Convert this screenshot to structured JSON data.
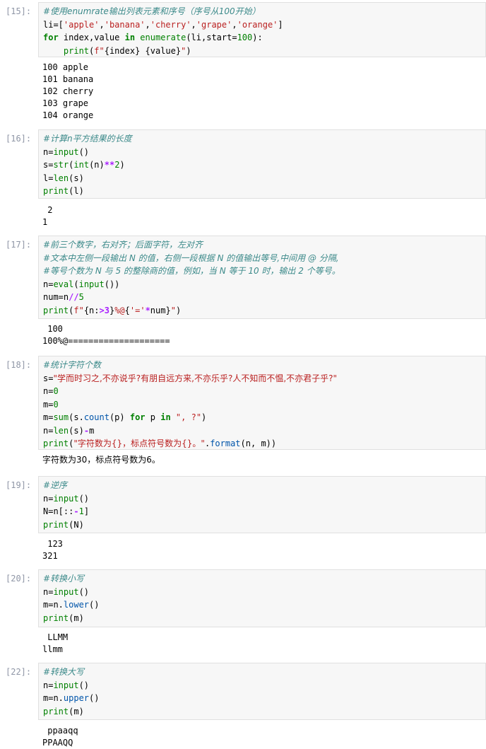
{
  "cells": [
    {
      "prompt": "[15]:",
      "code": [
        [
          [
            "cm",
            "#使用enumrate输出列表元素和序号（序号从100开始）"
          ]
        ],
        [
          [
            "",
            "li=["
          ],
          [
            "st",
            "'apple'"
          ],
          [
            "",
            ","
          ],
          [
            "st",
            "'banana'"
          ],
          [
            "",
            ","
          ],
          [
            "st",
            "'cherry'"
          ],
          [
            "",
            ","
          ],
          [
            "st",
            "'grape'"
          ],
          [
            "",
            ","
          ],
          [
            "st",
            "'orange'"
          ],
          [
            "",
            "]"
          ]
        ],
        [
          [
            "kw",
            "for"
          ],
          [
            "",
            " index,value "
          ],
          [
            "kw",
            "in"
          ],
          [
            "",
            " "
          ],
          [
            "bi",
            "enumerate"
          ],
          [
            "",
            "(li,start="
          ],
          [
            "nm",
            "100"
          ],
          [
            "",
            "):"
          ]
        ],
        [
          [
            "",
            "    "
          ],
          [
            "bi",
            "print"
          ],
          [
            "",
            "("
          ],
          [
            "st",
            "f\""
          ],
          [
            "",
            "{index}"
          ],
          [
            "st",
            " "
          ],
          [
            "",
            "{value}"
          ],
          [
            "st",
            "\""
          ],
          [
            "",
            ")"
          ]
        ]
      ],
      "output": [
        "100 apple",
        "101 banana",
        "102 cherry",
        "103 grape",
        "104 orange"
      ]
    },
    {
      "prompt": "[16]:",
      "code": [
        [
          [
            "cm",
            "#计算n平方结果的长度"
          ]
        ],
        [
          [
            "",
            "n="
          ],
          [
            "bi",
            "input"
          ],
          [
            "",
            "()"
          ]
        ],
        [
          [
            "",
            "s="
          ],
          [
            "bi",
            "str"
          ],
          [
            "",
            "("
          ],
          [
            "bi",
            "int"
          ],
          [
            "",
            "(n)"
          ],
          [
            "op",
            "**"
          ],
          [
            "nm",
            "2"
          ],
          [
            "",
            ")"
          ]
        ],
        [
          [
            "",
            "l="
          ],
          [
            "bi",
            "len"
          ],
          [
            "",
            "(s)"
          ]
        ],
        [
          [
            "bi",
            "print"
          ],
          [
            "",
            "(l)"
          ]
        ]
      ],
      "output": [
        " 2",
        "1"
      ]
    },
    {
      "prompt": "[17]:",
      "code": [
        [
          [
            "cm",
            "#前三个数字，右对齐；后面字符，左对齐"
          ]
        ],
        [
          [
            "cm",
            "#文本中左侧一段输出 N 的值，右侧一段根据 N 的值输出等号,中间用 @ 分隔,"
          ]
        ],
        [
          [
            "cm",
            "#等号个数为 N 与 5 的整除商的值，例如，当 N 等于 10 时，输出 2 个等号。"
          ]
        ],
        [
          [
            "",
            "n="
          ],
          [
            "bi",
            "eval"
          ],
          [
            "",
            "("
          ],
          [
            "bi",
            "input"
          ],
          [
            "",
            "())"
          ]
        ],
        [
          [
            "",
            "num=n"
          ],
          [
            "op",
            "//"
          ],
          [
            "nm",
            "5"
          ]
        ],
        [
          [
            "bi",
            "print"
          ],
          [
            "",
            "("
          ],
          [
            "st",
            "f\""
          ],
          [
            "",
            "{n:"
          ],
          [
            "op",
            ">3"
          ],
          [
            "",
            "}"
          ],
          [
            "st",
            "%@"
          ],
          [
            "",
            "{"
          ],
          [
            "st",
            "'='"
          ],
          [
            "op",
            "*"
          ],
          [
            "",
            "num}"
          ],
          [
            "st",
            "\""
          ],
          [
            "",
            ")"
          ]
        ]
      ],
      "output": [
        " 100",
        "100%@===================="
      ]
    },
    {
      "prompt": "[18]:",
      "code": [
        [
          [
            "cm",
            "#统计字符个数"
          ]
        ],
        [
          [
            "",
            "s="
          ],
          [
            "st",
            "\"学而时习之,不亦说乎?有朋自远方来,不亦乐乎?人不知而不愠,不亦君子乎?\""
          ]
        ],
        [
          [
            "",
            "n="
          ],
          [
            "nm",
            "0"
          ]
        ],
        [
          [
            "",
            "m="
          ],
          [
            "nm",
            "0"
          ]
        ],
        [
          [
            "",
            "m="
          ],
          [
            "bi",
            "sum"
          ],
          [
            "",
            "(s."
          ],
          [
            "fn",
            "count"
          ],
          [
            "",
            "(p) "
          ],
          [
            "kw",
            "for"
          ],
          [
            "",
            " p "
          ],
          [
            "kw",
            "in"
          ],
          [
            "",
            " "
          ],
          [
            "st",
            "\", ?\""
          ],
          [
            "",
            ")"
          ]
        ],
        [
          [
            "",
            "n="
          ],
          [
            "bi",
            "len"
          ],
          [
            "",
            "(s)"
          ],
          [
            "op",
            "-"
          ],
          [
            "",
            "m"
          ]
        ],
        [
          [
            "bi",
            "print"
          ],
          [
            "",
            "("
          ],
          [
            "st",
            "\"字符数为{}，标点符号数为{}。\""
          ],
          [
            "",
            "."
          ],
          [
            "fn",
            "format"
          ],
          [
            "",
            "(n, m))"
          ]
        ]
      ],
      "output": [
        "字符数为30，标点符号数为6。"
      ]
    },
    {
      "prompt": "[19]:",
      "code": [
        [
          [
            "cm",
            "#逆序"
          ]
        ],
        [
          [
            "",
            "n="
          ],
          [
            "bi",
            "input"
          ],
          [
            "",
            "()"
          ]
        ],
        [
          [
            "",
            "N=n[::"
          ],
          [
            "op",
            "-"
          ],
          [
            "nm",
            "1"
          ],
          [
            "",
            "]"
          ]
        ],
        [
          [
            "bi",
            "print"
          ],
          [
            "",
            "(N)"
          ]
        ]
      ],
      "output": [
        " 123",
        "321"
      ]
    },
    {
      "prompt": "[20]:",
      "code": [
        [
          [
            "cm",
            "#转换小写"
          ]
        ],
        [
          [
            "",
            "n="
          ],
          [
            "bi",
            "input"
          ],
          [
            "",
            "()"
          ]
        ],
        [
          [
            "",
            "m=n."
          ],
          [
            "fn",
            "lower"
          ],
          [
            "",
            "()"
          ]
        ],
        [
          [
            "bi",
            "print"
          ],
          [
            "",
            "(m)"
          ]
        ]
      ],
      "output": [
        " LLMM",
        "llmm"
      ]
    },
    {
      "prompt": "[22]:",
      "code": [
        [
          [
            "cm",
            "#转换大写"
          ]
        ],
        [
          [
            "",
            "n="
          ],
          [
            "bi",
            "input"
          ],
          [
            "",
            "()"
          ]
        ],
        [
          [
            "",
            "m=n."
          ],
          [
            "fn",
            "upper"
          ],
          [
            "",
            "()"
          ]
        ],
        [
          [
            "bi",
            "print"
          ],
          [
            "",
            "(m)"
          ]
        ]
      ],
      "output": [
        " ppaaqq",
        "PPAAQQ"
      ]
    }
  ]
}
